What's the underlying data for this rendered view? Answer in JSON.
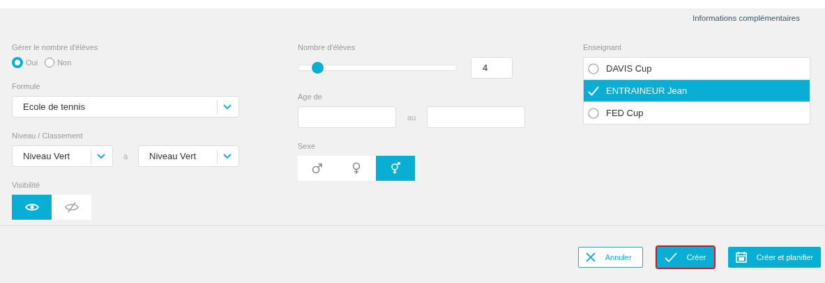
{
  "header_link": "Informations complémentaires",
  "manage_students": {
    "label": "Gérer le nombre d'élèves",
    "options": [
      {
        "label": "Oui",
        "selected": true
      },
      {
        "label": "Non",
        "selected": false
      }
    ]
  },
  "formule": {
    "label": "Formule",
    "value": "Ecole de tennis"
  },
  "niveau": {
    "label": "Niveau / Classement",
    "from": "Niveau Vert",
    "separator": "à",
    "to": "Niveau Vert"
  },
  "visibility": {
    "label": "Visibilité",
    "options": [
      {
        "kind": "visible",
        "selected": true
      },
      {
        "kind": "hidden",
        "selected": false
      }
    ]
  },
  "student_count": {
    "label": "Nombre d'élèves",
    "level": 0.12,
    "value": "4"
  },
  "age": {
    "label": "Age de",
    "separator": "au"
  },
  "sexe": {
    "label": "Sexe",
    "options": [
      {
        "kind": "male",
        "selected": false
      },
      {
        "kind": "female",
        "selected": false
      },
      {
        "kind": "mixed",
        "selected": true
      }
    ]
  },
  "teacher": {
    "label": "Enseignant",
    "items": [
      {
        "name": "DAVIS Cup",
        "selected": false
      },
      {
        "name": "ENTRAINEUR Jean",
        "selected": true
      },
      {
        "name": "FED Cup",
        "selected": false
      }
    ]
  },
  "buttons": [
    {
      "kind": "cancel",
      "label": "Annuler",
      "focused": false
    },
    {
      "kind": "create",
      "label": "Créer",
      "focused": true
    },
    {
      "kind": "schedule",
      "label": "Créer et planifier",
      "focused": false
    }
  ]
}
